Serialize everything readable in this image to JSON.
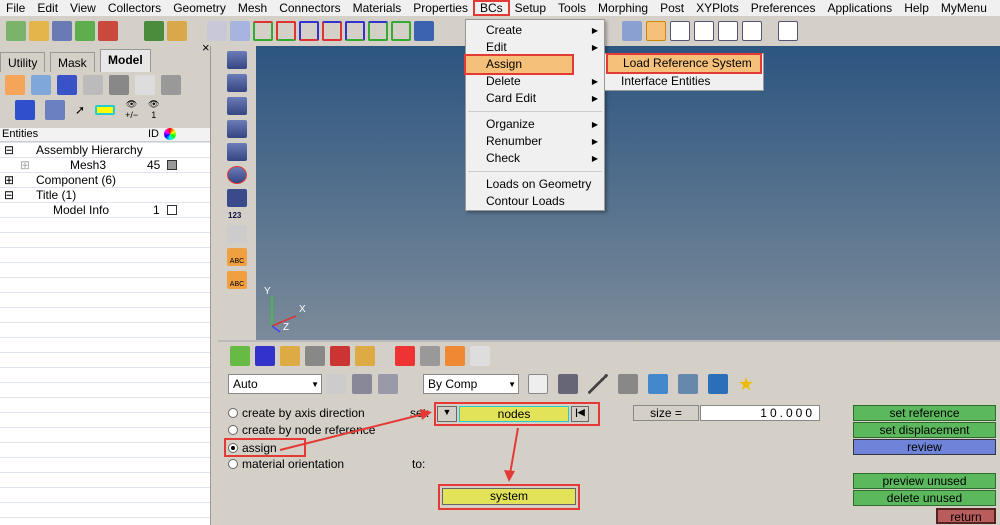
{
  "menubar": [
    "File",
    "Edit",
    "View",
    "Collectors",
    "Geometry",
    "Mesh",
    "Connectors",
    "Materials",
    "Properties",
    "BCs",
    "Setup",
    "Tools",
    "Morphing",
    "Post",
    "XYPlots",
    "Preferences",
    "Applications",
    "Help",
    "MyMenu"
  ],
  "left": {
    "tabs": [
      "Utility",
      "Mask",
      "Model"
    ],
    "close": "×",
    "header": {
      "entities": "Entities",
      "id": "ID"
    },
    "rows": [
      {
        "label": "Assembly Hierarchy",
        "id": ""
      },
      {
        "label": "Mesh3",
        "id": "45"
      },
      {
        "label": "Component (6)",
        "id": ""
      },
      {
        "label": "Title (1)",
        "id": ""
      },
      {
        "label": "Model Info",
        "id": "1"
      }
    ],
    "eye_labels": [
      "+/−",
      "1"
    ]
  },
  "strip": {
    "label123": "123",
    "abc": "ABC"
  },
  "bcs_menu": {
    "items": [
      "Create",
      "Edit",
      "Assign",
      "Delete",
      "Card Edit",
      "Organize",
      "Renumber",
      "Check",
      "Loads on Geometry",
      "Contour Loads"
    ],
    "submenu": [
      "Load Reference System",
      "Interface Entities"
    ]
  },
  "axes": {
    "y": "Y",
    "x": "X",
    "z": "Z"
  },
  "panel": {
    "auto": "Auto",
    "bycomp": "By Comp",
    "radios": [
      "create by axis direction",
      "create by node reference",
      "assign",
      "material orientation"
    ],
    "selected": "assign",
    "set_label": "set:",
    "to_label": "to:",
    "nodes": "nodes",
    "system": "system",
    "size_label": "size =",
    "size_value": "10.000",
    "buttons": [
      "set reference",
      "set displacement",
      "review",
      "preview unused",
      "delete unused",
      "return"
    ]
  },
  "colors": {
    "highlight": "#e53935",
    "green": "#5cb85c",
    "blue": "#6f83d8",
    "return": "#b85c5c",
    "yellow": "#e3e35a"
  }
}
